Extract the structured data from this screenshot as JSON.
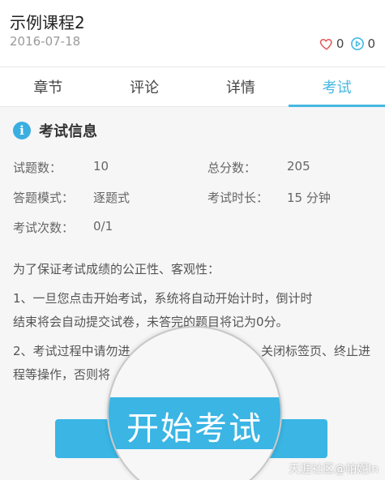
{
  "course": {
    "title": "示例课程2",
    "date": "2016-07-18",
    "likes": "0",
    "plays": "0"
  },
  "tabs": [
    {
      "label": "章节",
      "active": false
    },
    {
      "label": "评论",
      "active": false
    },
    {
      "label": "详情",
      "active": false
    },
    {
      "label": "考试",
      "active": true
    }
  ],
  "exam_info": {
    "title": "考试信息",
    "question_count_label": "试题数：",
    "question_count": "10",
    "total_score_label": "总分数：",
    "total_score": "205",
    "mode_label": "答题模式：",
    "mode": "逐题式",
    "duration_label": "考试时长：",
    "duration": "15 分钟",
    "attempts_label": "考试次数：",
    "attempts": "0/1"
  },
  "notice": {
    "intro": "为了保证考试成绩的公正性、客观性：",
    "rule1_line1": "1、一旦您点击开始考试，系统将自动开始计时，倒计时",
    "rule1_line2": "结束将会自动提交试卷，未答完的题目将记为0分。",
    "rule2_line1": "2、考试过程中请勿进",
    "rule2_line1_tail": "关闭标签页、终止进",
    "rule2_line2": "程等操作，否则将"
  },
  "start_button": {
    "label": "开始考试"
  },
  "watermark": "天涯社区@帕妮ln",
  "colors": {
    "accent": "#3ab5e4",
    "heart": "#e45b5b",
    "play": "#3ab5e4"
  },
  "icons": {
    "like": "heart-outline-icon",
    "plays": "play-circle-icon",
    "info": "info-circle-icon"
  }
}
